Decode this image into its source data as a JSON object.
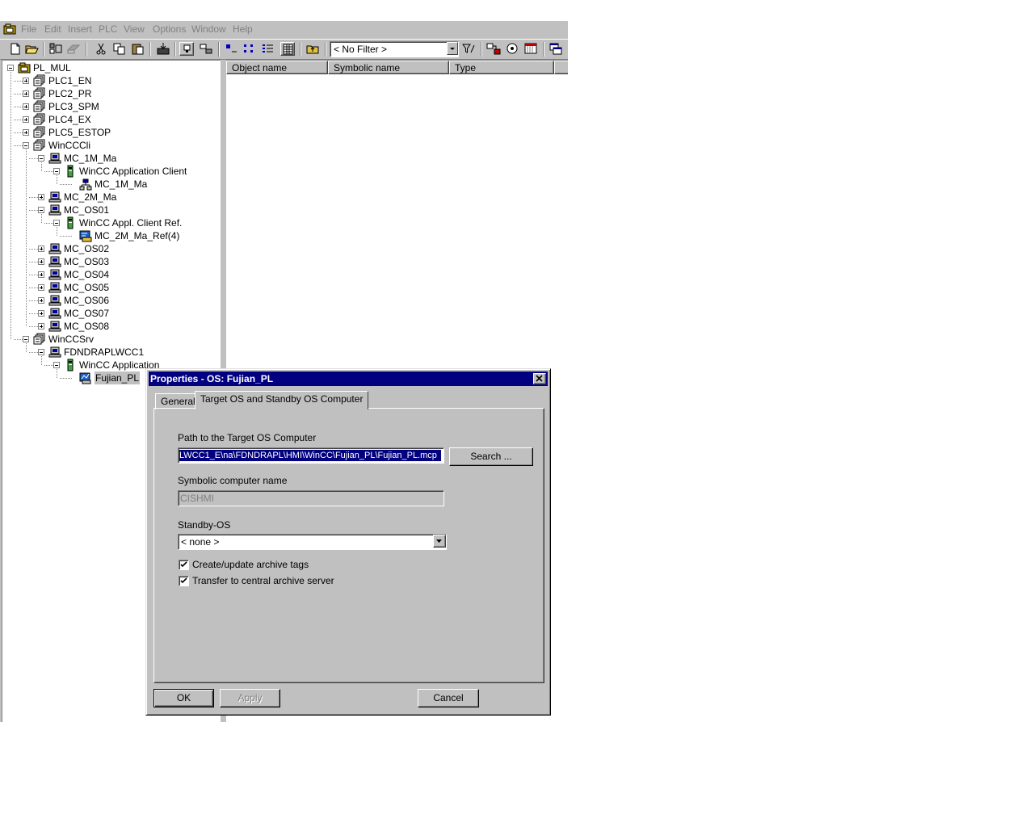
{
  "menu": [
    "File",
    "Edit",
    "Insert",
    "PLC",
    "View",
    "Options",
    "Window",
    "Help"
  ],
  "toolbar": {
    "filter_value": "< No Filter >"
  },
  "tree": [
    {
      "label": "PL_MUL",
      "level": 0,
      "toggle": "minus",
      "icon": "project-icon"
    },
    {
      "label": "PLC1_EN",
      "level": 1,
      "toggle": "plus",
      "icon": "station-icon"
    },
    {
      "label": "PLC2_PR",
      "level": 1,
      "toggle": "plus",
      "icon": "station-icon"
    },
    {
      "label": "PLC3_SPM",
      "level": 1,
      "toggle": "plus",
      "icon": "station-icon"
    },
    {
      "label": "PLC4_EX",
      "level": 1,
      "toggle": "plus",
      "icon": "station-icon"
    },
    {
      "label": "PLC5_ESTOP",
      "level": 1,
      "toggle": "plus",
      "icon": "station-icon"
    },
    {
      "label": "WinCCCli",
      "level": 1,
      "toggle": "minus",
      "icon": "station-icon"
    },
    {
      "label": "MC_1M_Ma",
      "level": 2,
      "toggle": "minus",
      "icon": "pc-icon"
    },
    {
      "label": "WinCC Application Client",
      "level": 3,
      "toggle": "minus",
      "icon": "app-icon"
    },
    {
      "label": "MC_1M_Ma",
      "level": 4,
      "toggle": "none",
      "icon": "network-icon"
    },
    {
      "label": "MC_2M_Ma",
      "level": 2,
      "toggle": "plus",
      "icon": "pc-icon"
    },
    {
      "label": "MC_OS01",
      "level": 2,
      "toggle": "minus",
      "icon": "pc-icon"
    },
    {
      "label": "WinCC Appl. Client Ref.",
      "level": 3,
      "toggle": "minus",
      "icon": "app-icon"
    },
    {
      "label": "MC_2M_Ma_Ref(4)",
      "level": 4,
      "toggle": "none",
      "icon": "os-ref-icon"
    },
    {
      "label": "MC_OS02",
      "level": 2,
      "toggle": "plus",
      "icon": "pc-icon"
    },
    {
      "label": "MC_OS03",
      "level": 2,
      "toggle": "plus",
      "icon": "pc-icon"
    },
    {
      "label": "MC_OS04",
      "level": 2,
      "toggle": "plus",
      "icon": "pc-icon"
    },
    {
      "label": "MC_OS05",
      "level": 2,
      "toggle": "plus",
      "icon": "pc-icon"
    },
    {
      "label": "MC_OS06",
      "level": 2,
      "toggle": "plus",
      "icon": "pc-icon"
    },
    {
      "label": "MC_OS07",
      "level": 2,
      "toggle": "plus",
      "icon": "pc-icon"
    },
    {
      "label": "MC_OS08",
      "level": 2,
      "toggle": "plus",
      "icon": "pc-icon"
    },
    {
      "label": "WinCCSrv",
      "level": 1,
      "toggle": "minus",
      "icon": "station-icon"
    },
    {
      "label": "FDNDRAPLWCC1",
      "level": 2,
      "toggle": "minus",
      "icon": "pc-icon"
    },
    {
      "label": "WinCC Application",
      "level": 3,
      "toggle": "minus",
      "icon": "app-icon"
    },
    {
      "label": "Fujian_PL",
      "level": 4,
      "toggle": "none",
      "icon": "os-icon",
      "selected": true
    }
  ],
  "list": {
    "columns": [
      "Object name",
      "Symbolic name",
      "Type"
    ]
  },
  "dialog": {
    "title": "Properties - OS: Fujian_PL",
    "tabs": [
      "General",
      "Target OS and Standby OS Computer"
    ],
    "path_label": "Path to the Target OS Computer",
    "path_value": "LWCC1_E\\na\\FDNDRAPL\\HMI\\WinCC\\Fujian_PL\\Fujian_PL.mcp",
    "search_label": "Search ...",
    "symbolic_label": "Symbolic computer name",
    "symbolic_value": "CISHMI",
    "standby_label": "Standby-OS",
    "standby_value": "< none >",
    "check1_label": "Create/update archive tags",
    "check2_label": "Transfer to central archive server",
    "ok_label": "OK",
    "apply_label": "Apply",
    "cancel_label": "Cancel"
  }
}
